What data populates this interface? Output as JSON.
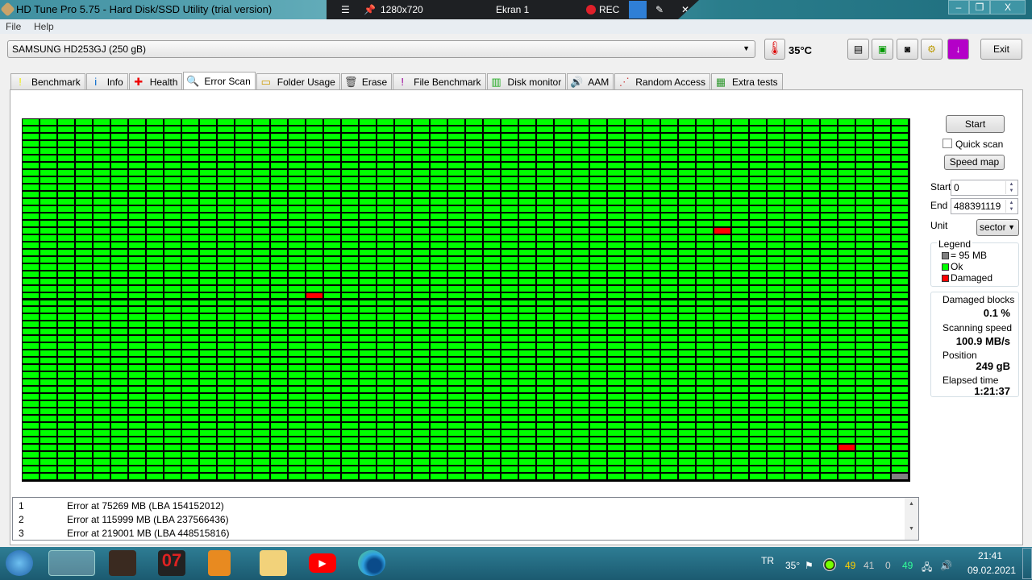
{
  "window": {
    "title": "HD Tune Pro 5.75 - Hard Disk/SSD Utility (trial version)",
    "minimize": "–",
    "restore": "❐",
    "close": "X"
  },
  "recorder": {
    "resolution": "1280x720",
    "screen": "Ekran 1",
    "rec": "REC"
  },
  "menu": {
    "file": "File",
    "help": "Help"
  },
  "toolbar": {
    "drive": "SAMSUNG HD253GJ (250 gB)",
    "temperature": "35°C",
    "exit": "Exit"
  },
  "tabs": [
    {
      "label": "Benchmark",
      "icon": "!"
    },
    {
      "label": "Info",
      "icon": "i"
    },
    {
      "label": "Health",
      "icon": "✚"
    },
    {
      "label": "Error Scan",
      "icon": "🔍"
    },
    {
      "label": "Folder Usage",
      "icon": "▭"
    },
    {
      "label": "Erase",
      "icon": "🗑"
    },
    {
      "label": "File Benchmark",
      "icon": "!"
    },
    {
      "label": "Disk monitor",
      "icon": "▥"
    },
    {
      "label": "AAM",
      "icon": "🔊"
    },
    {
      "label": "Random Access",
      "icon": "⋰"
    },
    {
      "label": "Extra tests",
      "icon": "▦"
    }
  ],
  "scan": {
    "columns": 50,
    "rows": 50,
    "damaged_blocks": [
      [
        15,
        39
      ],
      [
        24,
        16
      ],
      [
        45,
        46
      ]
    ],
    "unscanned_blocks": [
      [
        49,
        49
      ]
    ],
    "colors": {
      "ok": "#00ff00",
      "damaged": "#ff0000",
      "unscanned": "#808080"
    }
  },
  "controls": {
    "start": "Start",
    "quick_scan": "Quick scan",
    "quick_scan_checked": false,
    "speed_map": "Speed map",
    "start_label": "Start",
    "start_value": "0",
    "end_label": "End",
    "end_value": "488391119",
    "unit_label": "Unit",
    "unit_value": "sector"
  },
  "legend": {
    "title": "Legend",
    "block": "= 95 MB",
    "ok": "Ok",
    "damaged": "Damaged"
  },
  "stats": {
    "damaged_label": "Damaged blocks",
    "damaged_value": "0.1 %",
    "speed_label": "Scanning speed",
    "speed_value": "100.9 MB/s",
    "position_label": "Position",
    "position_value": "249 gB",
    "elapsed_label": "Elapsed time",
    "elapsed_value": "1:21:37"
  },
  "log": [
    {
      "n": "1",
      "text": "Error at 75269 MB (LBA 154152012)"
    },
    {
      "n": "2",
      "text": "Error at 115999 MB (LBA 237566436)"
    },
    {
      "n": "3",
      "text": "Error at 219001 MB (LBA 448515816)"
    }
  ],
  "taskbar": {
    "lang": "TR",
    "temp": "35°",
    "n1": "49",
    "n2": "41",
    "n3": "0",
    "n4": "49",
    "time": "21:41",
    "date": "09.02.2021"
  }
}
